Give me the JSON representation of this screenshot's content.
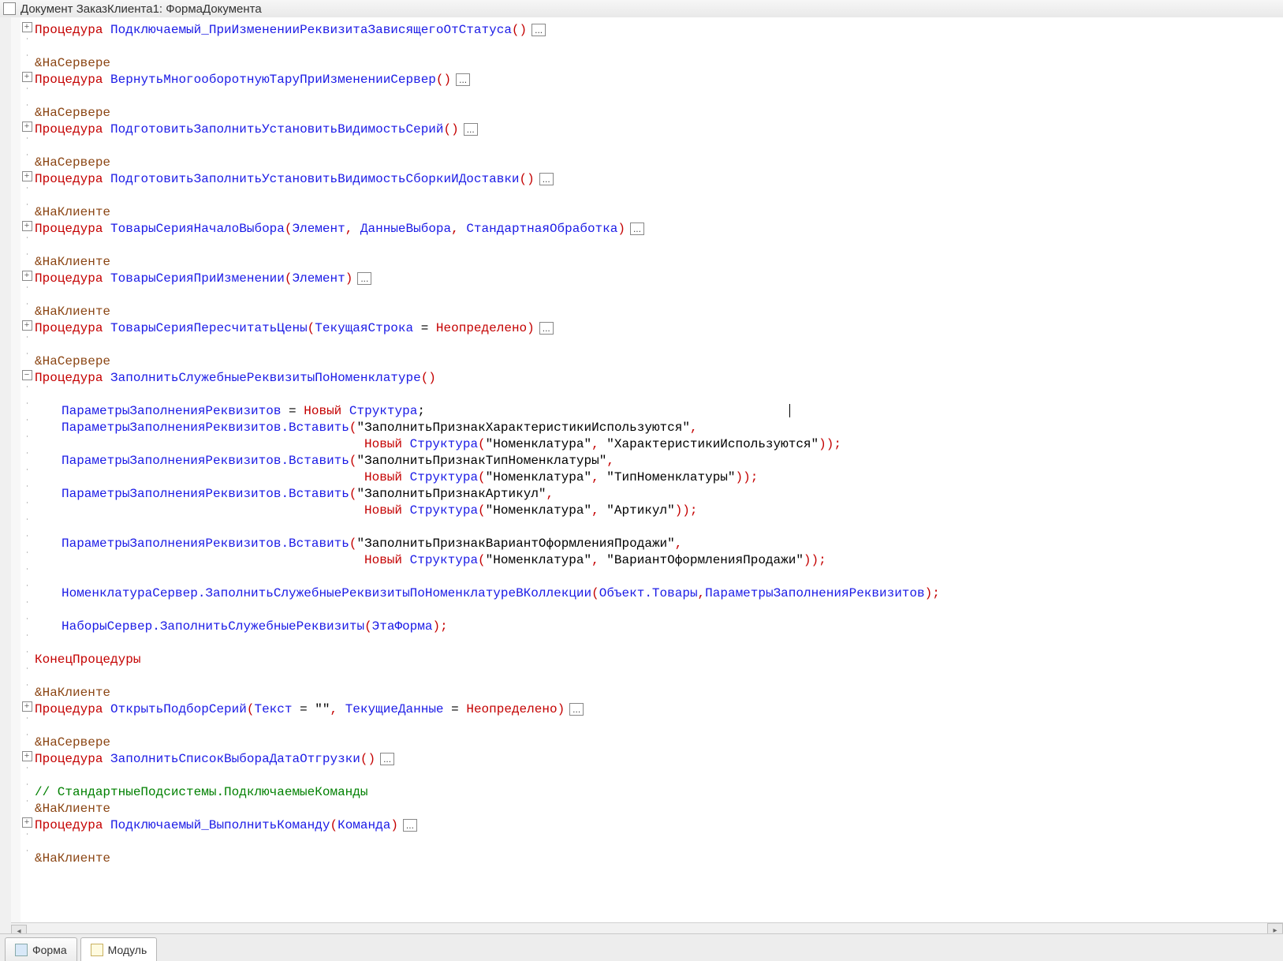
{
  "window": {
    "title": "Документ ЗаказКлиента1: ФормаДокумента"
  },
  "tabs": {
    "form": "Форма",
    "module": "Модуль"
  },
  "tokens": {
    "proc": "Процедура",
    "endproc": "КонецПроцедуры",
    "new": "Новый",
    "struct": "Структура",
    "undef": "Неопределено",
    "atserver": "&НаСервере",
    "atclient": "&НаКлиенте",
    "ellipsis": "..."
  },
  "proc1": {
    "name": "Подключаемый_ПриИзмененииРеквизитаЗависящегоОтСтатуса",
    "args": "()"
  },
  "proc2": {
    "name": "ВернутьМногооборотнуюТаруПриИзмененииСервер",
    "args": "()"
  },
  "proc3": {
    "name": "ПодготовитьЗаполнитьУстановитьВидимостьСерий",
    "args": "()"
  },
  "proc4": {
    "name": "ПодготовитьЗаполнитьУстановитьВидимостьСборкиИДоставки",
    "args": "()"
  },
  "proc5": {
    "name": "ТоварыСерияНачалоВыбора",
    "args_pre": "(",
    "a1": "Элемент",
    "c": ", ",
    "a2": "ДанныеВыбора",
    "a3": "СтандартнаяОбработка",
    "args_post": ")"
  },
  "proc6": {
    "name": "ТоварыСерияПриИзменении",
    "args_pre": "(",
    "a1": "Элемент",
    "args_post": ")"
  },
  "proc7": {
    "name": "ТоварыСерияПересчитатьЦены",
    "args_pre": "(",
    "a1": "ТекущаяСтрока",
    "eq": " = ",
    "args_post": ")"
  },
  "proc8": {
    "name": "ЗаполнитьСлужебныеРеквизитыПоНоменклатуре",
    "args": "()"
  },
  "proc9": {
    "name": "ОткрытьПодборСерий",
    "args_pre": "(",
    "a1": "Текст",
    "eq": " = ",
    "v1": "\"\"",
    "c": ", ",
    "a2": "ТекущиеДанные",
    "args_post": ")"
  },
  "proc10": {
    "name": "ЗаполнитьСписокВыбораДатаОтгрузки",
    "args": "()"
  },
  "proc11": {
    "name": "Подключаемый_ВыполнитьКоманду",
    "args_pre": "(",
    "a1": "Команда",
    "args_post": ")"
  },
  "body": {
    "l1": {
      "a": "ПараметрыЗаполненияРеквизитов",
      "eq": " = ",
      "semi": ";"
    },
    "l2": {
      "a": "ПараметрыЗаполненияРеквизитов",
      "m": ".Вставить",
      "p1": "(",
      "s": "\"ЗаполнитьПризнакХарактеристикиИспользуются\"",
      "c": ","
    },
    "l2b": {
      "p1": "(",
      "s1": "\"Номенклатура\"",
      "c": ", ",
      "s2": "\"ХарактеристикиИспользуются\"",
      "p2": "));"
    },
    "l3": {
      "a": "ПараметрыЗаполненияРеквизитов",
      "m": ".Вставить",
      "p1": "(",
      "s": "\"ЗаполнитьПризнакТипНоменклатуры\"",
      "c": ","
    },
    "l3b": {
      "p1": "(",
      "s1": "\"Номенклатура\"",
      "c": ", ",
      "s2": "\"ТипНоменклатуры\"",
      "p2": "));"
    },
    "l4": {
      "a": "ПараметрыЗаполненияРеквизитов",
      "m": ".Вставить",
      "p1": "(",
      "s": "\"ЗаполнитьПризнакАртикул\"",
      "c": ","
    },
    "l4b": {
      "p1": "(",
      "s1": "\"Номенклатура\"",
      "c": ", ",
      "s2": "\"Артикул\"",
      "p2": "));"
    },
    "l5": {
      "a": "ПараметрыЗаполненияРеквизитов",
      "m": ".Вставить",
      "p1": "(",
      "s": "\"ЗаполнитьПризнакВариантОформленияПродажи\"",
      "c": ","
    },
    "l5b": {
      "p1": "(",
      "s1": "\"Номенклатура\"",
      "c": ", ",
      "s2": "\"ВариантОформленияПродажи\"",
      "p2": "));"
    },
    "l6": {
      "a": "НоменклатураСервер",
      "m": ".ЗаполнитьСлужебныеРеквизитыПоНоменклатуреВКоллекции",
      "p1": "(",
      "a1": "Объект",
      "m1": ".Товары",
      "c": ",",
      "a2": "ПараметрыЗаполненияРеквизитов",
      "p2": ");"
    },
    "l7": {
      "a": "НаборыСервер",
      "m": ".ЗаполнитьСлужебныеРеквизиты",
      "p1": "(",
      "a1": "ЭтаФорма",
      "p2": ");"
    }
  },
  "comment": "// СтандартныеПодсистемы.ПодключаемыеКоманды"
}
